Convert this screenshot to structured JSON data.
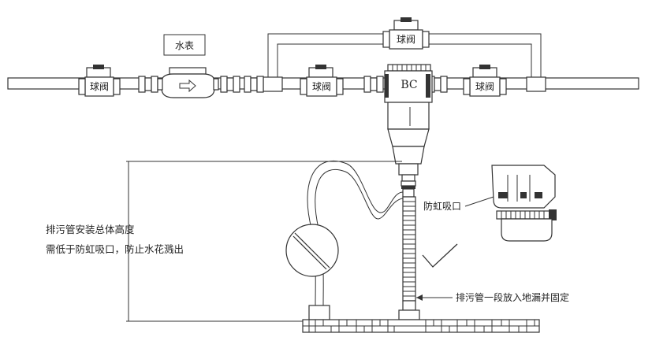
{
  "labels": {
    "meter_box": "水表",
    "valve_left": "球阀",
    "valve_mid": "球阀",
    "valve_right": "球阀",
    "valve_bypass": "球阀",
    "filter_logo": "BC",
    "siphon_inlet": "防虹吸口",
    "height_note_line1": "排污管安装总体高度",
    "height_note_line2": "需低于防虹吸口，防止水花溅出",
    "drain_note": "排污管一段放入地漏并固定"
  }
}
